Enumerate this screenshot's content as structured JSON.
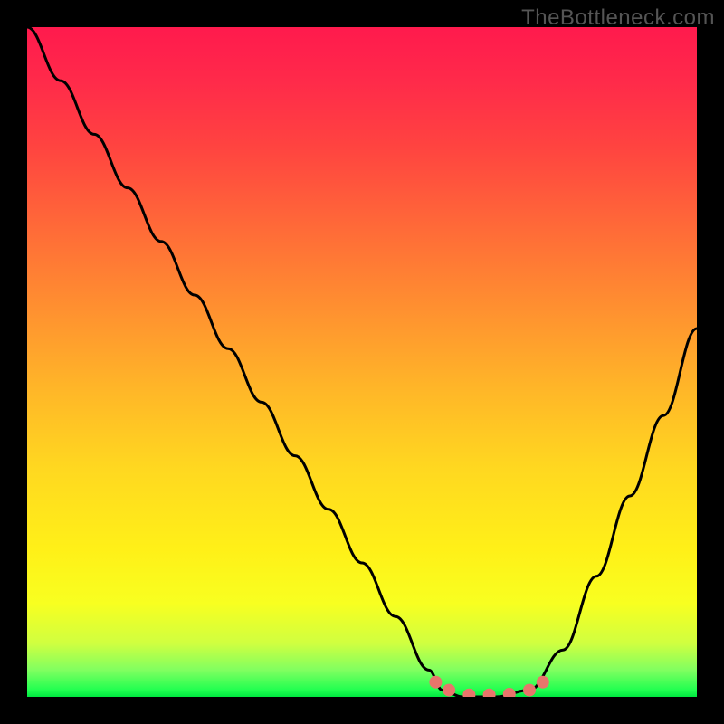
{
  "watermark": "TheBottleneck.com",
  "chart_data": {
    "type": "line",
    "title": "",
    "xlabel": "",
    "ylabel": "",
    "xlim": [
      0,
      100
    ],
    "ylim": [
      0,
      100
    ],
    "grid": false,
    "series": [
      {
        "name": "bottleneck-curve",
        "color": "#000000",
        "x": [
          0,
          5,
          10,
          15,
          20,
          25,
          30,
          35,
          40,
          45,
          50,
          55,
          60,
          62,
          65,
          70,
          75,
          80,
          85,
          90,
          95,
          100
        ],
        "values": [
          100,
          92,
          84,
          76,
          68,
          60,
          52,
          44,
          36,
          28,
          20,
          12,
          4,
          1,
          0,
          0,
          1,
          7,
          18,
          30,
          42,
          55
        ]
      }
    ],
    "markers": {
      "name": "optimal-zone",
      "color": "#e8756b",
      "points": [
        {
          "x": 61,
          "y": 2.2
        },
        {
          "x": 63,
          "y": 1.0
        },
        {
          "x": 66,
          "y": 0.3
        },
        {
          "x": 69,
          "y": 0.3
        },
        {
          "x": 72,
          "y": 0.4
        },
        {
          "x": 75,
          "y": 1.0
        },
        {
          "x": 77,
          "y": 2.2
        }
      ]
    },
    "background_gradient": {
      "type": "vertical",
      "stops": [
        {
          "pos": 0,
          "color": "#ff1a4d"
        },
        {
          "pos": 50,
          "color": "#ffb020"
        },
        {
          "pos": 100,
          "color": "#00e840"
        }
      ]
    }
  }
}
